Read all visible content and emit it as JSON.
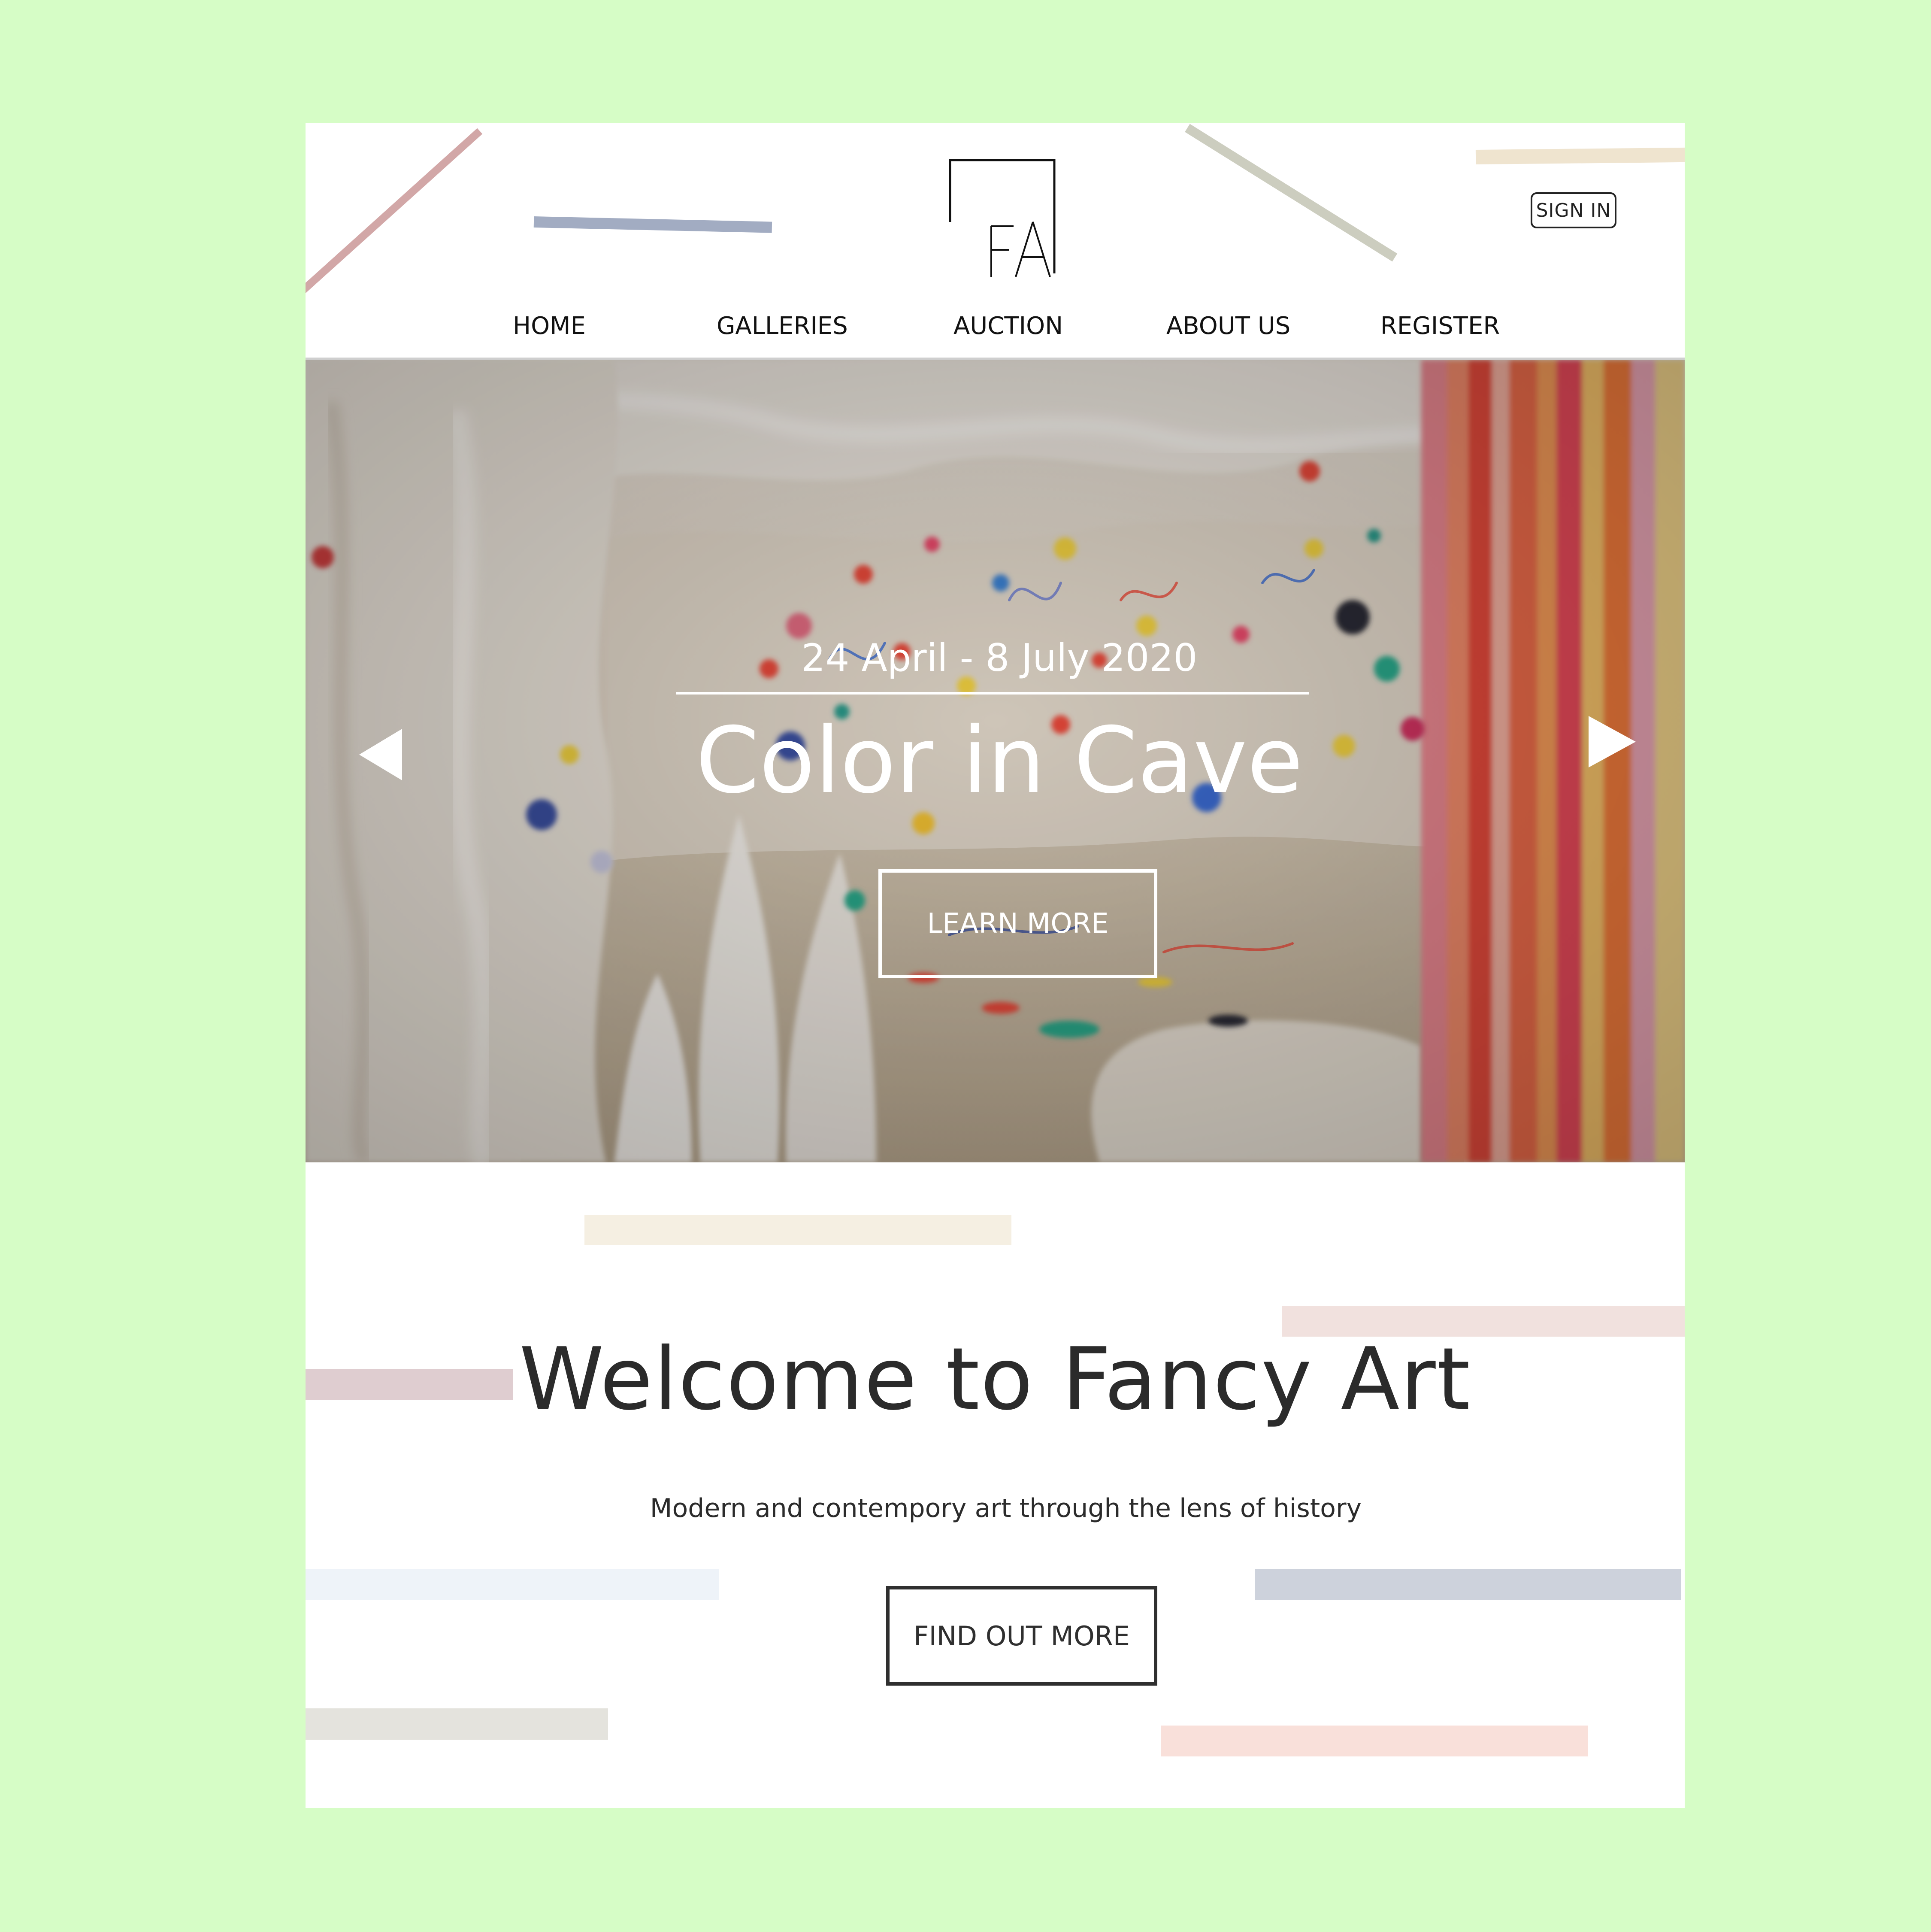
{
  "site": {
    "logo_letters": "FA",
    "sign_in_label": "SIGN IN"
  },
  "nav": {
    "items": [
      {
        "label": "HOME"
      },
      {
        "label": "GALLERIES"
      },
      {
        "label": "AUCTION"
      },
      {
        "label": "ABOUT US"
      },
      {
        "label": "REGISTER"
      }
    ]
  },
  "hero": {
    "date_range": "24 April - 8 July 2020",
    "title": "Color in Cave",
    "cta_label": "LEARN MORE",
    "prev_icon": "caret-left-icon",
    "next_icon": "caret-right-icon"
  },
  "welcome": {
    "heading": "Welcome to Fancy Art",
    "tagline": "Modern and contempory art through the lens of history",
    "cta_label": "FIND OUT MORE"
  },
  "colors": {
    "page_background": "#d6fdc6",
    "card_background": "#ffffff",
    "text_dark": "#2b2b2b",
    "hero_text": "#ffffff"
  }
}
